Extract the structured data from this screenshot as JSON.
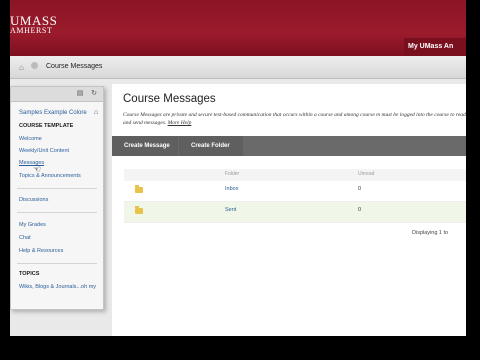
{
  "header": {
    "logo_line1": "UMASS",
    "logo_line2": "AMHERST",
    "my_umass": "My UMass An"
  },
  "breadcrumb": {
    "current": "Course Messages"
  },
  "sidebar": {
    "course_name": "Samples Example Colore",
    "section_template": "COURSE TEMPLATE",
    "items_a": [
      "Welcome",
      "Weekly/Unit Content",
      "Messages",
      "Topics & Announcements"
    ],
    "items_b": [
      "Discussions"
    ],
    "items_c": [
      "My Grades",
      "Chat",
      "Help & Resources"
    ],
    "section_topics": "TOPICS",
    "topics_item": "Wikis, Blogs & Journals...oh my"
  },
  "main": {
    "title": "Course Messages",
    "description": "Course Messages are private and secure text-based communication that occurs within a course and among course m must be logged into the course to read and send messages.",
    "more_help": "More Help",
    "actions": [
      "Create Message",
      "Create Folder"
    ],
    "columns": [
      "Folder",
      "Unread"
    ],
    "rows": [
      {
        "name": "Inbox",
        "unread": "0"
      },
      {
        "name": "Sent",
        "unread": "0"
      }
    ],
    "displaying": "Displaying 1 to"
  }
}
